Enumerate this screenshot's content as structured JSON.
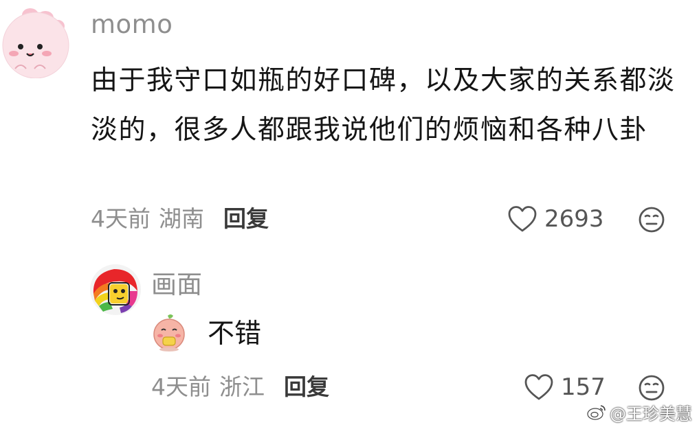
{
  "main_comment": {
    "username": "momo",
    "text": "由于我守口如瓶的好口碑，以及大家的关系都淡淡的，很多人都跟我说他们的烦恼和各种八卦",
    "time": "4天前",
    "location": "湖南",
    "reply_label": "回复",
    "likes": "2693"
  },
  "reply": {
    "username": "画面",
    "text": "不错",
    "time": "4天前",
    "location": "浙江",
    "reply_label": "回复",
    "likes": "157"
  },
  "watermark": {
    "text": "@王珍美慧"
  },
  "icons": {
    "like": "heart-outline-icon",
    "reaction": "meh-face-icon",
    "source": "weibo-logo-icon"
  },
  "colors": {
    "meta_gray": "#8e8e8e",
    "text": "#151515",
    "icon_gray": "#555555"
  }
}
